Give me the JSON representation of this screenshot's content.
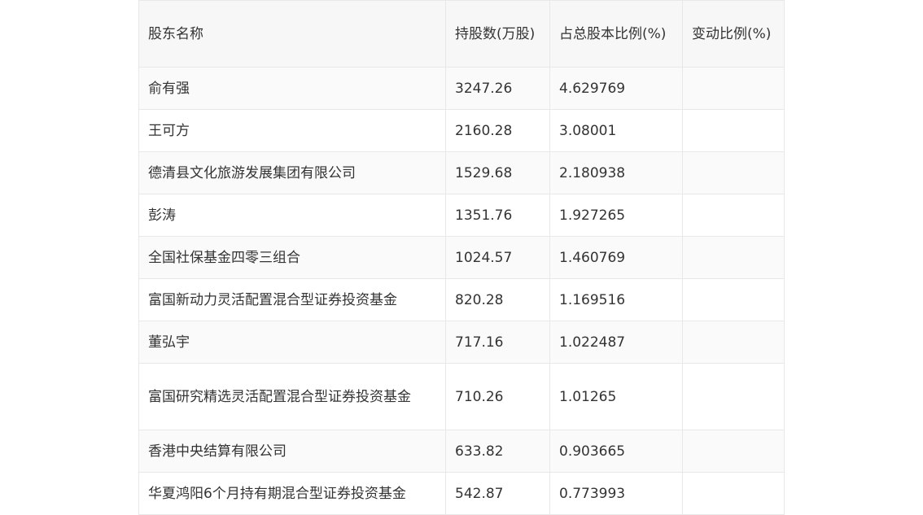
{
  "table": {
    "headers": [
      "股东名称",
      "持股数(万股)",
      "占总股本比例(%)",
      "变动比例(%)"
    ],
    "rows": [
      {
        "name": "俞有强",
        "shares": "3247.26",
        "ratio": "4.629769",
        "change": ""
      },
      {
        "name": "王可方",
        "shares": "2160.28",
        "ratio": "3.08001",
        "change": ""
      },
      {
        "name": "德清县文化旅游发展集团有限公司",
        "shares": "1529.68",
        "ratio": "2.180938",
        "change": ""
      },
      {
        "name": "彭涛",
        "shares": "1351.76",
        "ratio": "1.927265",
        "change": ""
      },
      {
        "name": "全国社保基金四零三组合",
        "shares": "1024.57",
        "ratio": "1.460769",
        "change": ""
      },
      {
        "name": "富国新动力灵活配置混合型证券投资基金",
        "shares": "820.28",
        "ratio": "1.169516",
        "change": ""
      },
      {
        "name": "董弘宇",
        "shares": "717.16",
        "ratio": "1.022487",
        "change": ""
      },
      {
        "name": "富国研究精选灵活配置混合型证券投资基金",
        "shares": "710.26",
        "ratio": "1.01265",
        "change": ""
      },
      {
        "name": "香港中央结算有限公司",
        "shares": "633.82",
        "ratio": "0.903665",
        "change": ""
      },
      {
        "name": "华夏鸿阳6个月持有期混合型证券投资基金",
        "shares": "542.87",
        "ratio": "0.773993",
        "change": ""
      }
    ]
  }
}
